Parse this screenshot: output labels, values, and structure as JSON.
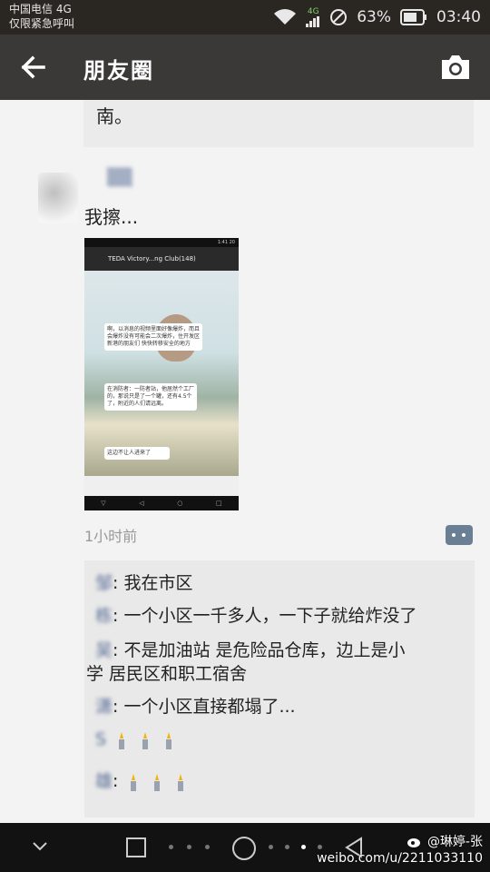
{
  "status_bar": {
    "carrier": "中国电信 4G",
    "carrier_note": "仅限紧急呼叫",
    "network": "4G",
    "battery": "63%",
    "time": "03:40"
  },
  "titlebar": {
    "title": "朋友圈"
  },
  "feed": {
    "previous_comment_tail": "南。",
    "post": {
      "text": "我擦...",
      "time": "1小时前",
      "embedded_screenshot": {
        "chat_title": "TEDA Victory...ng Club(148)",
        "status_time": "1:41 20",
        "bubble_1": "啊，以消息的视频里面好像爆炸，而且会爆炸没有可能会二次爆炸，住开发区 新港的朋友们 快快转移安全的地方",
        "bubble_2": "在消防者：一防者站，他居然个工厂的，那说只是了一个罐，还有4.5个了，附近的人们请远离。",
        "bubble_3": "这边不让人进来了"
      }
    },
    "comments": [
      {
        "name": "邹",
        "text": "我在市区"
      },
      {
        "name": "栋",
        "text": "一个小区一千多人，一下子就给炸没了"
      },
      {
        "name": "吴",
        "text": "不是加油站 是危险品仓库，边上是小"
      },
      {
        "name": "",
        "text": "学 居民区和职工宿舍"
      },
      {
        "name": "潇",
        "text": "一个小区直接都塌了..."
      },
      {
        "name": "S",
        "text": ""
      },
      {
        "name": "雄",
        "text": ""
      }
    ]
  },
  "watermark": {
    "handle": "@琳婷-张",
    "url": "weibo.com/u/2211033110"
  },
  "icons": [
    "wifi-icon",
    "signal-icon",
    "no-disturb-icon",
    "battery-icon",
    "back-arrow-icon",
    "camera-icon",
    "comment-dots-icon",
    "candle-icon",
    "chevron-down-icon",
    "square-icon",
    "circle-icon",
    "triangle-back-icon",
    "weibo-icon"
  ]
}
